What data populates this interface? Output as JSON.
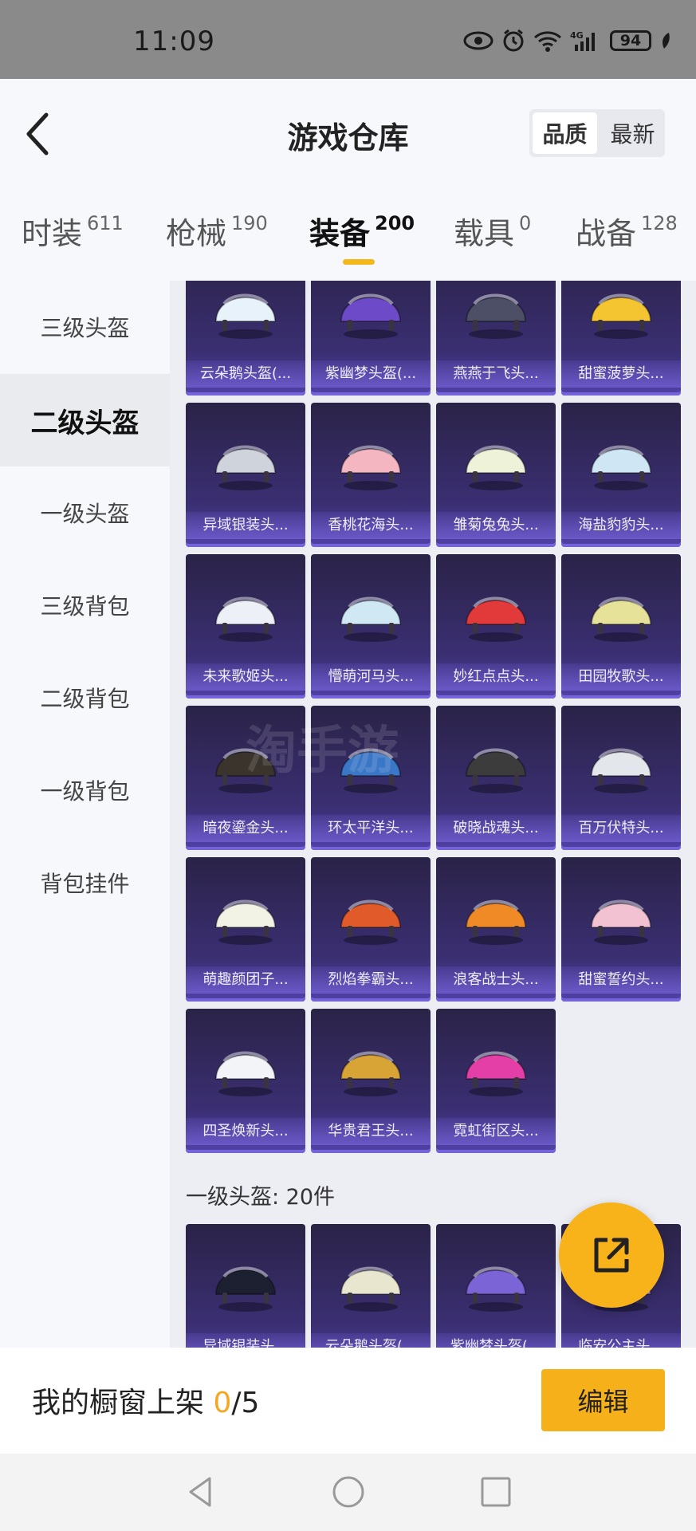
{
  "status_bar": {
    "time": "11:09",
    "battery": "94"
  },
  "header": {
    "title": "游戏仓库",
    "sort_options": [
      "品质",
      "最新"
    ],
    "sort_active": "品质"
  },
  "tabs": [
    {
      "label": "时装",
      "count": "611"
    },
    {
      "label": "枪械",
      "count": "190"
    },
    {
      "label": "装备",
      "count": "200",
      "active": true
    },
    {
      "label": "载具",
      "count": "0"
    },
    {
      "label": "战备",
      "count": "128"
    }
  ],
  "sidebar": {
    "items": [
      "三级头盔",
      "二级头盔",
      "一级头盔",
      "三级背包",
      "二级背包",
      "一级背包",
      "背包挂件"
    ],
    "active_index": 1
  },
  "grid": {
    "items": [
      {
        "name": "云朵鹅头盔(...",
        "color": "#e8f2fb"
      },
      {
        "name": "紫幽梦头盔(...",
        "color": "#6d4bc8"
      },
      {
        "name": "燕燕于飞头...",
        "color": "#4c4f66"
      },
      {
        "name": "甜蜜菠萝头...",
        "color": "#f4c531"
      },
      {
        "name": "异域银装头...",
        "color": "#cfd4dc"
      },
      {
        "name": "香桃花海头...",
        "color": "#f4b6c1"
      },
      {
        "name": "雏菊兔兔头...",
        "color": "#eef2d9"
      },
      {
        "name": "海盐豹豹头...",
        "color": "#cfe6f5"
      },
      {
        "name": "未来歌姬头...",
        "color": "#eef0f8"
      },
      {
        "name": "懵萌河马头...",
        "color": "#cfe8f4"
      },
      {
        "name": "妙红点点头...",
        "color": "#e23a3a"
      },
      {
        "name": "田园牧歌头...",
        "color": "#e6e29a"
      },
      {
        "name": "暗夜鎏金头...",
        "color": "#3a342c"
      },
      {
        "name": "环太平洋头...",
        "color": "#3b77c7"
      },
      {
        "name": "破晓战魂头...",
        "color": "#3c3c3c"
      },
      {
        "name": "百万伏特头...",
        "color": "#e3e6ea"
      },
      {
        "name": "萌趣颜团子...",
        "color": "#f2f3e4"
      },
      {
        "name": "烈焰拳霸头...",
        "color": "#e05a2a"
      },
      {
        "name": "浪客战士头...",
        "color": "#f08a26"
      },
      {
        "name": "甜蜜誓约头...",
        "color": "#f3c2d2"
      },
      {
        "name": "四圣焕新头...",
        "color": "#f2f4f7"
      },
      {
        "name": "华贵君王头...",
        "color": "#d8a436"
      },
      {
        "name": "霓虹街区头...",
        "color": "#e43fa7"
      }
    ]
  },
  "section2": {
    "label": "一级头盔: 20件",
    "items": [
      {
        "name": "异域银装头...",
        "color": "#1d2030"
      },
      {
        "name": "云朵鹅头盔(...",
        "color": "#e9e6cf"
      },
      {
        "name": "紫幽梦头盔(...",
        "color": "#7a64d6"
      },
      {
        "name": "临安公主头...",
        "color": "#b08fd8"
      }
    ]
  },
  "bottom": {
    "text_prefix": "我的橱窗上架 ",
    "count": "0",
    "text_suffix": "/5",
    "edit_label": "编辑"
  },
  "watermark": "淘手游"
}
